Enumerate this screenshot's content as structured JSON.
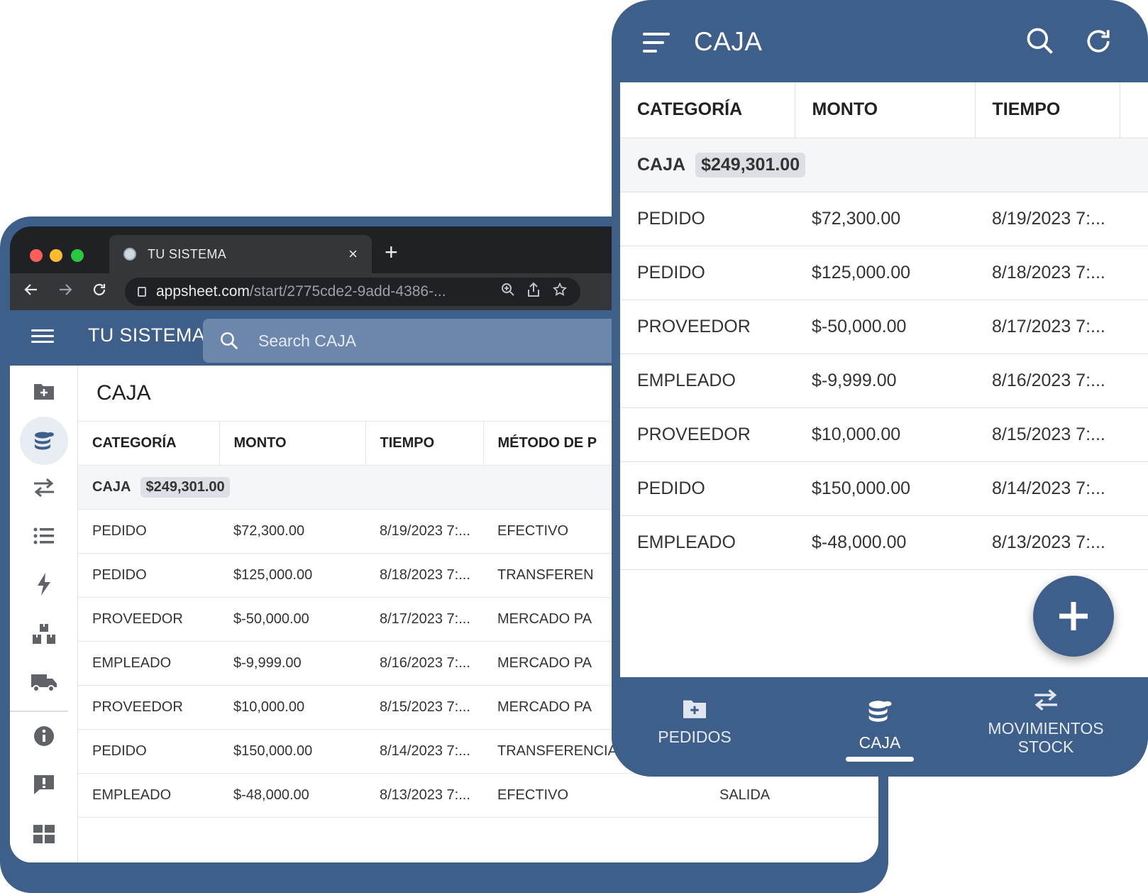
{
  "browser": {
    "tab_title": "TU SISTEMA",
    "tab_close": "×",
    "new_tab": "+",
    "url_host": "appsheet.com",
    "url_path": "/start/2775cde2-9add-4386-..."
  },
  "desktop": {
    "app_title": "TU SISTEMA",
    "search_placeholder": "Search CAJA",
    "view_title": "CAJA",
    "columns": [
      "CATEGORÍA",
      "MONTO",
      "TIEMPO",
      "MÉTODO DE P"
    ],
    "group": {
      "label": "CAJA",
      "total": "$249,301.00"
    },
    "rows": [
      {
        "categoria": "PEDIDO",
        "monto": "$72,300.00",
        "tiempo": "8/19/2023 7:...",
        "metodo": "EFECTIVO",
        "extra": ""
      },
      {
        "categoria": "PEDIDO",
        "monto": "$125,000.00",
        "tiempo": "8/18/2023 7:...",
        "metodo": "TRANSFEREN",
        "extra": ""
      },
      {
        "categoria": "PROVEEDOR",
        "monto": "$-50,000.00",
        "tiempo": "8/17/2023 7:...",
        "metodo": "MERCADO PA",
        "extra": ""
      },
      {
        "categoria": "EMPLEADO",
        "monto": "$-9,999.00",
        "tiempo": "8/16/2023 7:...",
        "metodo": "MERCADO PA",
        "extra": ""
      },
      {
        "categoria": "PROVEEDOR",
        "monto": "$10,000.00",
        "tiempo": "8/15/2023 7:...",
        "metodo": "MERCADO PA",
        "extra": ""
      },
      {
        "categoria": "PEDIDO",
        "monto": "$150,000.00",
        "tiempo": "8/14/2023 7:...",
        "metodo": "TRANSFERENCIA",
        "extra": ""
      },
      {
        "categoria": "EMPLEADO",
        "monto": "$-48,000.00",
        "tiempo": "8/13/2023 7:...",
        "metodo": "EFECTIVO",
        "extra": "SALIDA"
      }
    ],
    "rail_icons": [
      "folder-plus-icon",
      "coins-icon",
      "transfer-arrows-icon",
      "list-icon",
      "lightning-icon",
      "boxes-icon",
      "truck-icon",
      "info-icon",
      "feedback-icon",
      "grid-icon"
    ]
  },
  "phone": {
    "title": "CAJA",
    "columns": [
      "CATEGORÍA",
      "MONTO",
      "TIEMPO"
    ],
    "group": {
      "label": "CAJA",
      "total": "$249,301.00"
    },
    "rows": [
      {
        "categoria": "PEDIDO",
        "monto": "$72,300.00",
        "tiempo": "8/19/2023 7:..."
      },
      {
        "categoria": "PEDIDO",
        "monto": "$125,000.00",
        "tiempo": "8/18/2023 7:..."
      },
      {
        "categoria": "PROVEEDOR",
        "monto": "$-50,000.00",
        "tiempo": "8/17/2023 7:..."
      },
      {
        "categoria": "EMPLEADO",
        "monto": "$-9,999.00",
        "tiempo": "8/16/2023 7:..."
      },
      {
        "categoria": "PROVEEDOR",
        "monto": "$10,000.00",
        "tiempo": "8/15/2023 7:..."
      },
      {
        "categoria": "PEDIDO",
        "monto": "$150,000.00",
        "tiempo": "8/14/2023 7:..."
      },
      {
        "categoria": "EMPLEADO",
        "monto": "$-48,000.00",
        "tiempo": "8/13/2023 7:..."
      }
    ],
    "nav": [
      {
        "label": "PEDIDOS",
        "icon": "folder-plus-icon",
        "active": false
      },
      {
        "label": "CAJA",
        "icon": "coins-icon",
        "active": true
      },
      {
        "label_line1": "MOVIMIENTOS",
        "label_line2": "STOCK",
        "icon": "transfer-arrows-icon",
        "active": false
      }
    ]
  },
  "colors": {
    "brand": "#3e5f89",
    "positive": "#2e9e2e",
    "negative": "#c62828"
  }
}
